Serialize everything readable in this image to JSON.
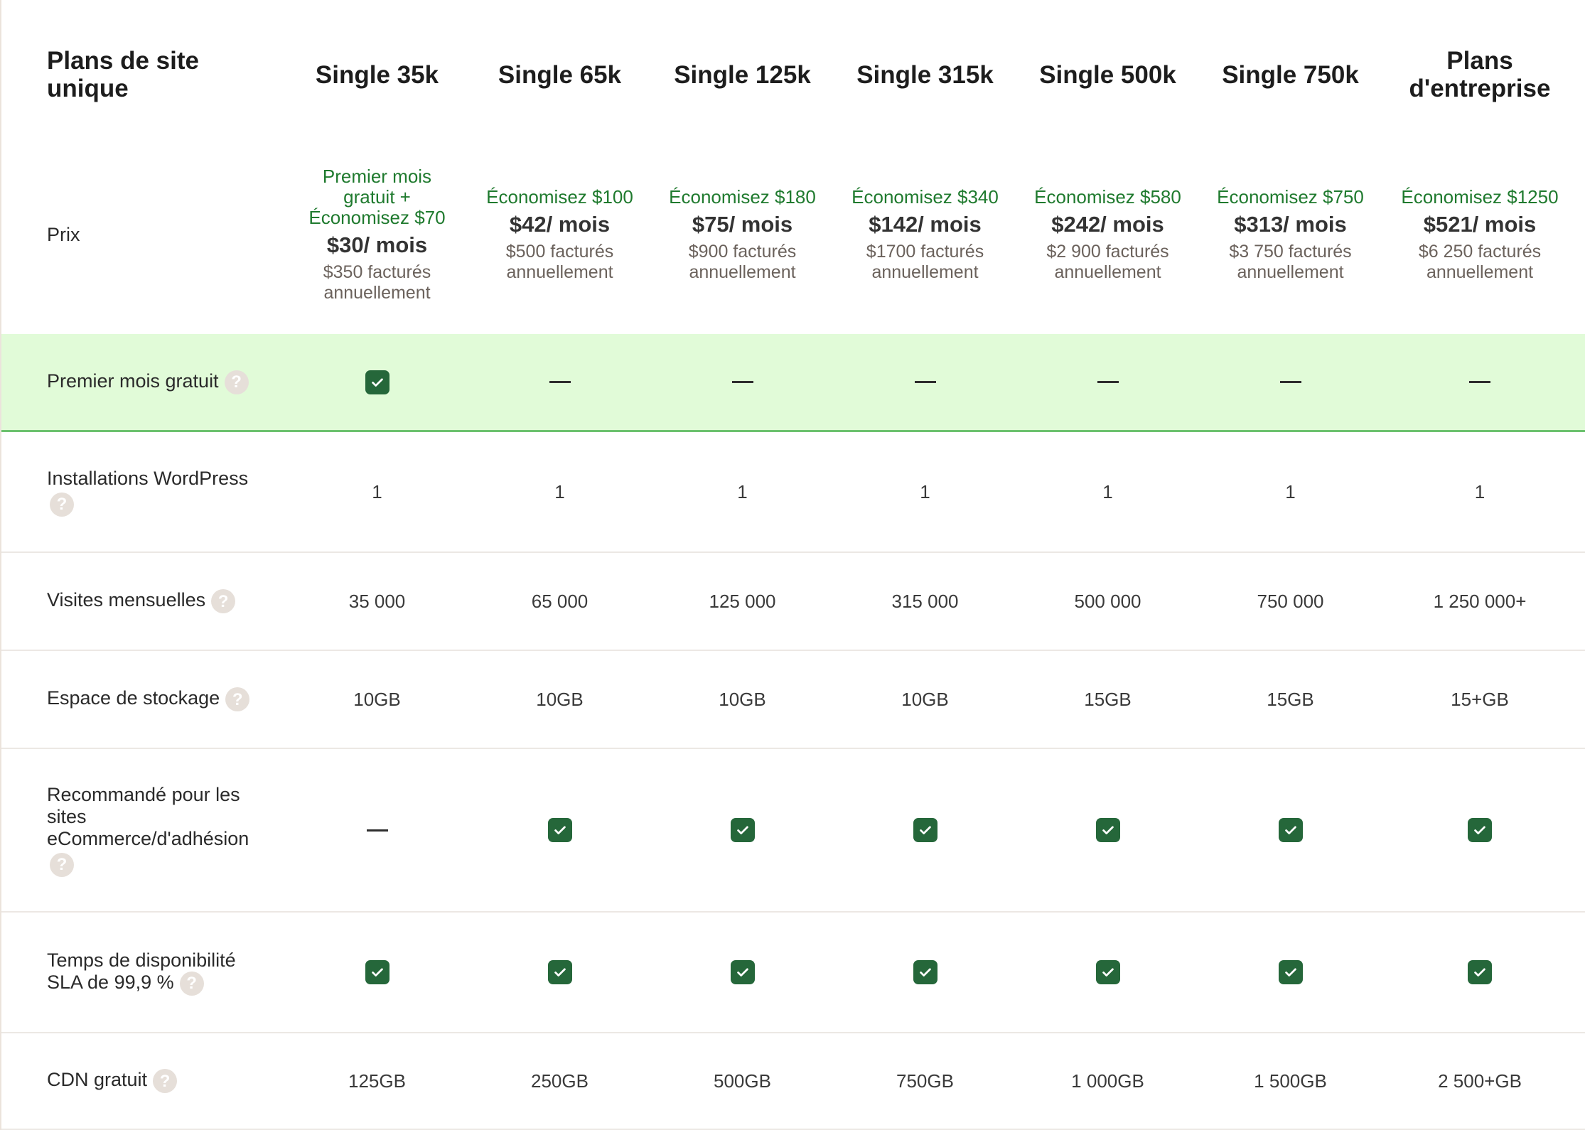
{
  "table_title": "Plans de site unique",
  "plans": [
    {
      "name": "Single 35k",
      "save": "Premier mois gratuit + Économisez $70",
      "price": "$30/ mois",
      "billed": "$350 facturés annuellement"
    },
    {
      "name": "Single 65k",
      "save": "Économisez $100",
      "price": "$42/ mois",
      "billed": "$500 facturés annuellement"
    },
    {
      "name": "Single 125k",
      "save": "Économisez $180",
      "price": "$75/ mois",
      "billed": "$900 facturés annuellement"
    },
    {
      "name": "Single 315k",
      "save": "Économisez $340",
      "price": "$142/ mois",
      "billed": "$1700 facturés annuellement"
    },
    {
      "name": "Single 500k",
      "save": "Économisez $580",
      "price": "$242/ mois",
      "billed": "$2 900 facturés annuellement"
    },
    {
      "name": "Single 750k",
      "save": "Économisez $750",
      "price": "$313/ mois",
      "billed": "$3 750 facturés annuellement"
    },
    {
      "name": "Plans d'entreprise",
      "save": "Économisez $1250",
      "price": "$521/ mois",
      "billed": "$6 250 facturés annuellement"
    }
  ],
  "price_label": "Prix",
  "rows": [
    {
      "label": "Premier mois gratuit",
      "highlight": true,
      "help_inline": true,
      "values": [
        {
          "type": "check"
        },
        {
          "type": "dash"
        },
        {
          "type": "dash"
        },
        {
          "type": "dash"
        },
        {
          "type": "dash"
        },
        {
          "type": "dash"
        },
        {
          "type": "dash"
        }
      ]
    },
    {
      "label": "Installations WordPress",
      "help_inline": false,
      "values": [
        {
          "type": "text",
          "text": "1"
        },
        {
          "type": "text",
          "text": "1"
        },
        {
          "type": "text",
          "text": "1"
        },
        {
          "type": "text",
          "text": "1"
        },
        {
          "type": "text",
          "text": "1"
        },
        {
          "type": "text",
          "text": "1"
        },
        {
          "type": "text",
          "text": "1"
        }
      ]
    },
    {
      "label": "Visites mensuelles",
      "help_inline": true,
      "values": [
        {
          "type": "text",
          "text": "35 000"
        },
        {
          "type": "text",
          "text": "65 000"
        },
        {
          "type": "text",
          "text": "125 000"
        },
        {
          "type": "text",
          "text": "315 000"
        },
        {
          "type": "text",
          "text": "500 000"
        },
        {
          "type": "text",
          "text": "750 000"
        },
        {
          "type": "text",
          "text": "1 250 000+"
        }
      ]
    },
    {
      "label": "Espace de stockage",
      "help_inline": true,
      "values": [
        {
          "type": "text",
          "text": "10GB"
        },
        {
          "type": "text",
          "text": "10GB"
        },
        {
          "type": "text",
          "text": "10GB"
        },
        {
          "type": "text",
          "text": "10GB"
        },
        {
          "type": "text",
          "text": "15GB"
        },
        {
          "type": "text",
          "text": "15GB"
        },
        {
          "type": "text",
          "text": "15+GB"
        }
      ]
    },
    {
      "label": "Recommandé pour les sites eCommerce/d'adhésion",
      "help_inline": false,
      "values": [
        {
          "type": "dash"
        },
        {
          "type": "check"
        },
        {
          "type": "check"
        },
        {
          "type": "check"
        },
        {
          "type": "check"
        },
        {
          "type": "check"
        },
        {
          "type": "check"
        }
      ]
    },
    {
      "label": "Temps de disponibilité SLA de 99,9 %",
      "help_inline": true,
      "values": [
        {
          "type": "check"
        },
        {
          "type": "check"
        },
        {
          "type": "check"
        },
        {
          "type": "check"
        },
        {
          "type": "check"
        },
        {
          "type": "check"
        },
        {
          "type": "check"
        }
      ]
    },
    {
      "label": "CDN gratuit",
      "help_inline": true,
      "values": [
        {
          "type": "text",
          "text": "125GB"
        },
        {
          "type": "text",
          "text": "250GB"
        },
        {
          "type": "text",
          "text": "500GB"
        },
        {
          "type": "text",
          "text": "750GB"
        },
        {
          "type": "text",
          "text": "1 000GB"
        },
        {
          "type": "text",
          "text": "1 500GB"
        },
        {
          "type": "text",
          "text": "2 500+GB"
        }
      ]
    }
  ],
  "help_glyph": "?",
  "colors": {
    "accent_green": "#1f7a2e",
    "check_bg": "#25673a",
    "highlight_bg": "#e1fbd8",
    "highlight_border": "#6cc26e"
  },
  "icons": {
    "check": "check-icon",
    "help": "help-icon",
    "dash": "dash-icon"
  }
}
